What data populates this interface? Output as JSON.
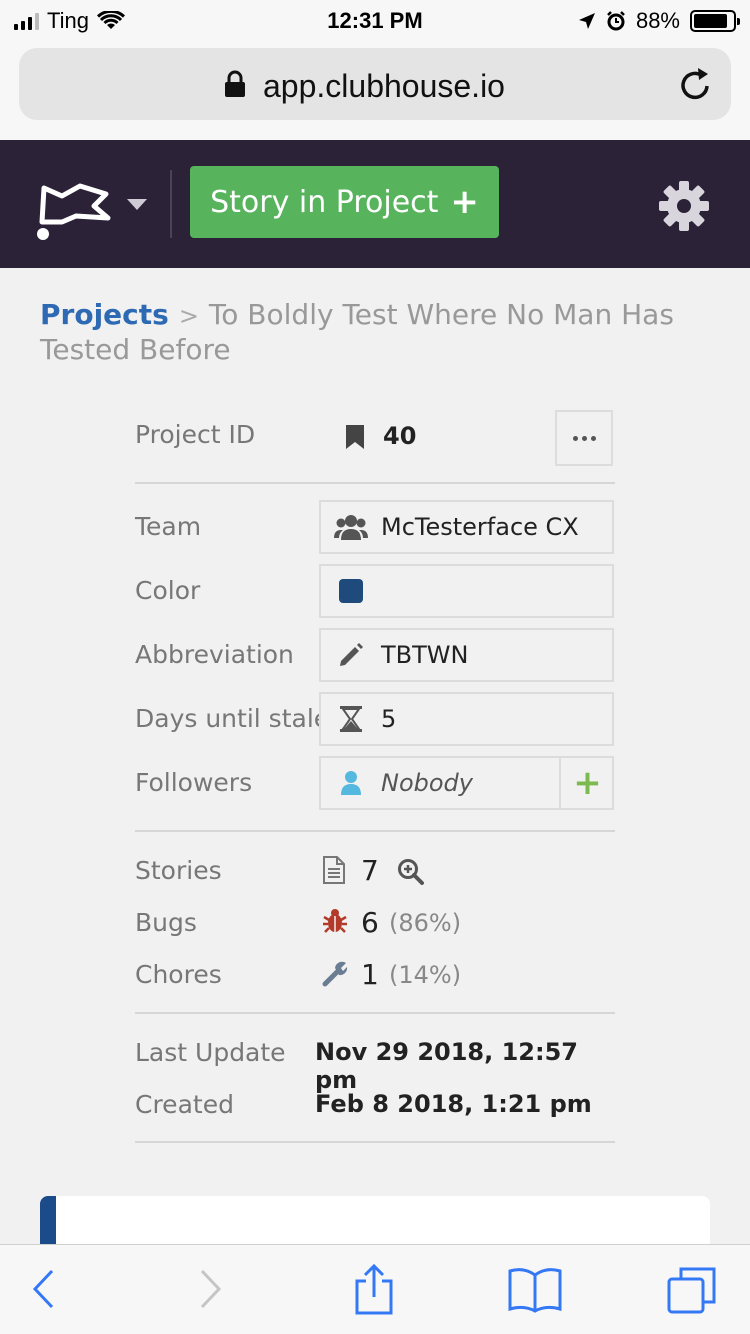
{
  "status_bar": {
    "carrier": "Ting",
    "time": "12:31 PM",
    "battery": "88%",
    "battery_level": 0.88
  },
  "browser": {
    "url": "app.clubhouse.io"
  },
  "header": {
    "new_button_label": "Story in Project",
    "new_button_icon": "plus-icon",
    "settings_icon": "gear-icon"
  },
  "breadcrumb": {
    "root": "Projects",
    "separator": ">",
    "current": "To Boldly Test Where No Man Has Tested Before"
  },
  "project": {
    "id_label": "Project ID",
    "id_value": "40",
    "team_label": "Team",
    "team_value": "McTesterface CX",
    "color_label": "Color",
    "color_value": "#1f4a7c",
    "abbreviation_label": "Abbreviation",
    "abbreviation_value": "TBTWN",
    "stale_label": "Days until stale",
    "stale_value": "5",
    "followers_label": "Followers",
    "followers_value": "Nobody",
    "stories_label": "Stories",
    "stories_count": "7",
    "bugs_label": "Bugs",
    "bugs_count": "6",
    "bugs_pct": "(86%)",
    "chores_label": "Chores",
    "chores_count": "1",
    "chores_pct": "(14%)",
    "last_update_label": "Last Update",
    "last_update_value": "Nov 29 2018, 12:57 pm",
    "created_label": "Created",
    "created_value": "Feb 8 2018, 1:21 pm"
  },
  "colors": {
    "header_bg": "#2b2238",
    "accent_green": "#58b45c",
    "link_blue": "#2e6ab4",
    "bug_red": "#b33a2a"
  }
}
